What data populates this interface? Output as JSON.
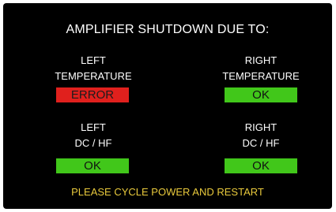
{
  "title": "AMPLIFIER SHUTDOWN DUE TO:",
  "left_temperature": {
    "label_line1": "LEFT",
    "label_line2": "TEMPERATURE",
    "status": "ERROR",
    "status_color": "#e0201d"
  },
  "right_temperature": {
    "label_line1": "RIGHT",
    "label_line2": "TEMPERATURE",
    "status": "OK",
    "status_color": "#41c71a"
  },
  "left_dc_hf": {
    "label_line1": "LEFT",
    "label_line2": "DC / HF",
    "status": "OK",
    "status_color": "#41c71a"
  },
  "right_dc_hf": {
    "label_line1": "RIGHT",
    "label_line2": "DC / HF",
    "status": "OK",
    "status_color": "#41c71a"
  },
  "footer": "PLEASE CYCLE POWER AND RESTART",
  "colors": {
    "background": "#000000",
    "text": "#ffffff",
    "footer_text": "#e8c93c"
  }
}
